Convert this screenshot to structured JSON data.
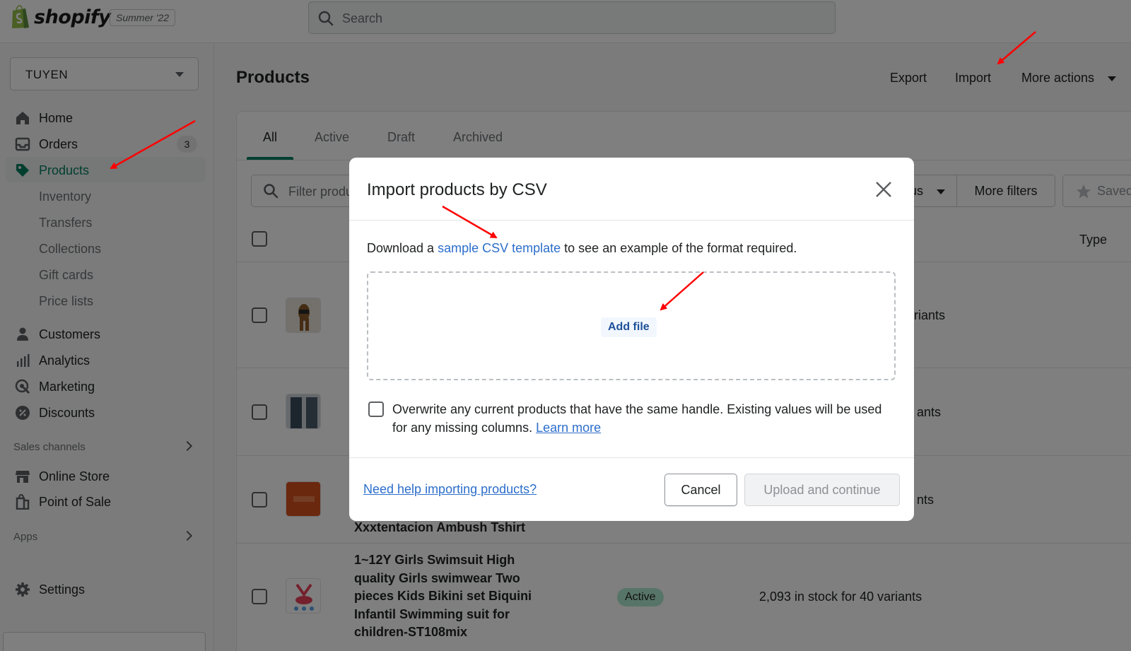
{
  "app": {
    "brand": "shopify",
    "edition": "Summer '22",
    "search_placeholder": "Search"
  },
  "sidebar": {
    "store_name": "TUYEN",
    "items": [
      {
        "label": "Home",
        "icon": "home-icon"
      },
      {
        "label": "Orders",
        "icon": "orders-icon",
        "badge": "3"
      },
      {
        "label": "Products",
        "icon": "tag-icon",
        "active": true
      },
      {
        "label": "Inventory"
      },
      {
        "label": "Transfers"
      },
      {
        "label": "Collections"
      },
      {
        "label": "Gift cards"
      },
      {
        "label": "Price lists"
      },
      {
        "label": "Customers",
        "icon": "person-icon"
      },
      {
        "label": "Analytics",
        "icon": "bar-chart-icon"
      },
      {
        "label": "Marketing",
        "icon": "target-icon"
      },
      {
        "label": "Discounts",
        "icon": "discount-icon"
      }
    ],
    "sales_channels_heading": "Sales channels",
    "channels": [
      {
        "label": "Online Store",
        "icon": "store-icon"
      },
      {
        "label": "Point of Sale",
        "icon": "pos-icon"
      }
    ],
    "apps_heading": "Apps",
    "settings_label": "Settings"
  },
  "page": {
    "title": "Products",
    "actions": {
      "export": "Export",
      "import": "Import",
      "more": "More actions"
    },
    "tabs": [
      "All",
      "Active",
      "Draft",
      "Archived"
    ],
    "filter_placeholder": "Filter products",
    "status_suffix": "us",
    "more_filters": "More filters",
    "saved": "Saved",
    "col_type": "Type",
    "rows": [
      {
        "inventory_fragment": "riants"
      },
      {
        "inventory_fragment": "ants"
      },
      {
        "inventory_fragment": "nts",
        "name": "Xxxtentacion Ambush Tshirt"
      },
      {
        "name_lines": [
          "1~12Y Girls Swimsuit High",
          "quality Girls swimwear Two",
          "pieces Kids Bikini set Biquini",
          "Infantil Swimming suit for",
          "children-ST108mix"
        ],
        "status": "Active",
        "inventory": "2,093 in stock for 40 variants"
      }
    ]
  },
  "modal": {
    "title": "Import products by CSV",
    "desc_before": "Download a ",
    "desc_link": "sample CSV template",
    "desc_after": " to see an example of the format required.",
    "add_file": "Add file",
    "overwrite_text": "Overwrite any current products that have the same handle. Existing values will be used for any missing columns.",
    "learn_more": "Learn more",
    "help_link": "Need help importing products?",
    "cancel": "Cancel",
    "upload": "Upload and continue"
  },
  "colors": {
    "accent": "#008060",
    "link": "#2c6ecb",
    "annotation_arrow": "#ff0000",
    "active_nav": "#007f5f"
  }
}
